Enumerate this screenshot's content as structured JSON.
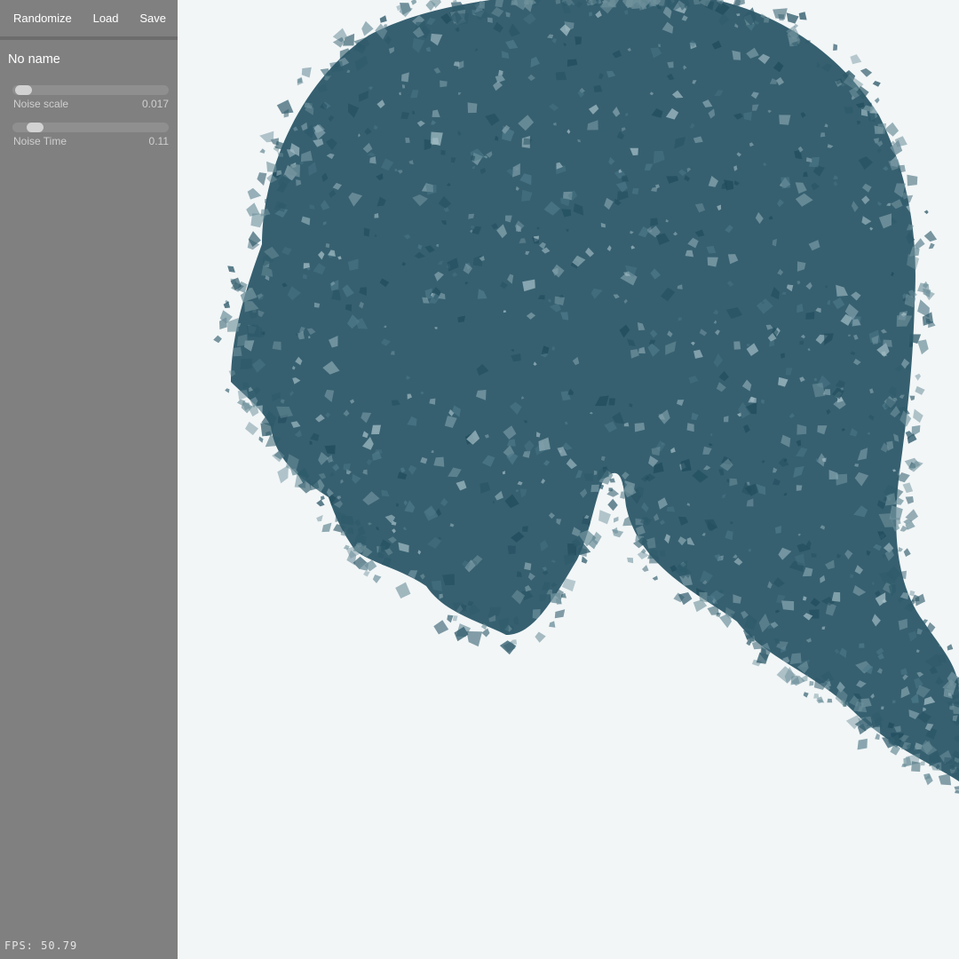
{
  "toolbar": {
    "randomize_label": "Randomize",
    "load_label": "Load",
    "save_label": "Save"
  },
  "preset": {
    "name": "No name"
  },
  "params": [
    {
      "label": "Noise scale",
      "value": "0.017",
      "level": 0.02
    },
    {
      "label": "Noise Time",
      "value": "0.11",
      "level": 0.1
    }
  ],
  "fps": "FPS: 50.79",
  "colors": {
    "sidebar": "#808080",
    "canvas_bg": "#f2f6f7",
    "particle": "#2e5a6a",
    "particle_dark": "#1f4b5b",
    "particle_light": "#8aa8b2"
  }
}
